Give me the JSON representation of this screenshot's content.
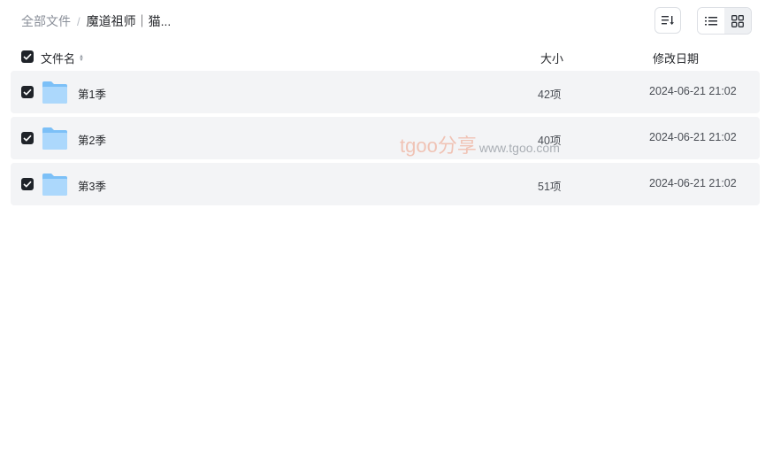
{
  "breadcrumb": {
    "root": "全部文件",
    "separator": "/",
    "current": "魔道祖师｜猫..."
  },
  "toolbar": {
    "sort_icon": "sort-list-icon",
    "list_view_icon": "list-view-icon",
    "grid_view_icon": "grid-view-icon"
  },
  "table": {
    "columns": {
      "name": "文件名",
      "size": "大小",
      "date": "修改日期"
    },
    "rows": [
      {
        "name": "第1季",
        "size": "42项",
        "date": "2024-06-21 21:02",
        "checked": true,
        "icon": "folder-icon"
      },
      {
        "name": "第2季",
        "size": "40项",
        "date": "2024-06-21 21:02",
        "checked": true,
        "icon": "folder-icon"
      },
      {
        "name": "第3季",
        "size": "51项",
        "date": "2024-06-21 21:02",
        "checked": true,
        "icon": "folder-icon"
      }
    ]
  },
  "watermark": {
    "brand": "tgoo分享",
    "site": "www.tgoo.com"
  },
  "colors": {
    "row_bg": "#f3f4f6",
    "checkbox": "#1f2329",
    "folder_light": "#a6d4fb",
    "folder_dark": "#62b2f5"
  }
}
